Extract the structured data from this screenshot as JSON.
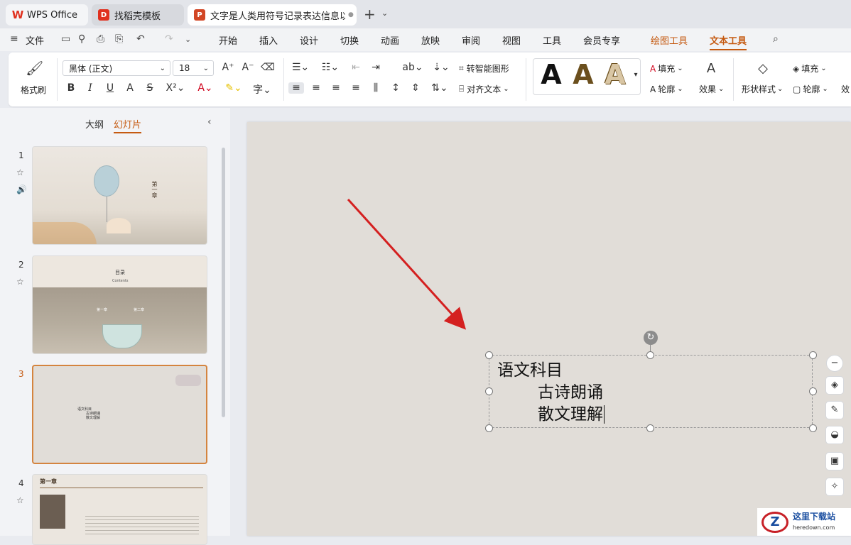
{
  "tabs": [
    {
      "label": "WPS Office",
      "icon": "wps-logo-icon"
    },
    {
      "label": "找稻壳模板",
      "icon": "docer-icon"
    },
    {
      "label": "文字是人类用符号记录表达信息以",
      "icon": "presentation-icon",
      "status": "●"
    }
  ],
  "menu": {
    "file": "文件",
    "items": [
      "开始",
      "插入",
      "设计",
      "切换",
      "动画",
      "放映",
      "审阅",
      "视图",
      "工具",
      "会员专享"
    ],
    "context": [
      "绘图工具",
      "文本工具"
    ],
    "active": "文本工具"
  },
  "ribbon": {
    "format_painter": "格式刷",
    "font_name": "黑体 (正文)",
    "font_size": "18",
    "smart_art": "转智能图形",
    "align_text": "对齐文本",
    "fill": "填充",
    "outline": "轮廓",
    "effect": "效果",
    "shape_style": "形状样式",
    "fill2": "填充",
    "outline2": "轮廓",
    "effect2": "效",
    "text_style_letters": [
      "A",
      "A",
      "A"
    ]
  },
  "sidebar": {
    "tab_outline": "大纲",
    "tab_slides": "幻灯片",
    "slides": [
      {
        "num": "1",
        "title": "第一章"
      },
      {
        "num": "2",
        "title": "目录",
        "subtitle": "Contents",
        "items": [
          "第一章",
          "第二章"
        ]
      },
      {
        "num": "3",
        "lines": [
          "语文科目",
          "古诗朗诵",
          "散文理解"
        ]
      },
      {
        "num": "4",
        "title": "第一章"
      }
    ]
  },
  "slide": {
    "text_lines": [
      "语文科目",
      "古诗朗诵",
      "散文理解"
    ]
  },
  "watermark": {
    "title": "这里下载站",
    "url": "heredown.com"
  },
  "colors": {
    "accent": "#c55a11",
    "arrow": "#d42020",
    "slide_bg": "#e1ddd8"
  }
}
